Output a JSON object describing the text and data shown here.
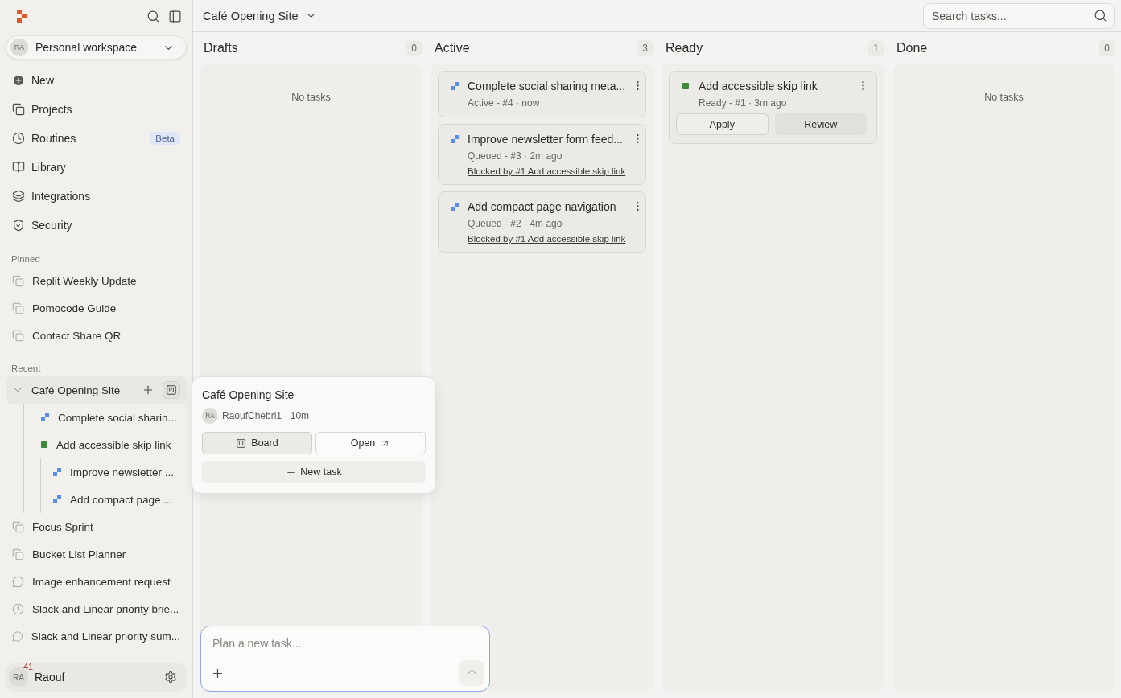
{
  "sidebar": {
    "workspace": {
      "avatar": "RA",
      "name": "Personal workspace"
    },
    "nav": [
      {
        "label": "New",
        "kind": "new"
      },
      {
        "label": "Projects",
        "kind": "projects"
      },
      {
        "label": "Routines",
        "kind": "routines",
        "badge": "Beta"
      },
      {
        "label": "Library",
        "kind": "library"
      },
      {
        "label": "Integrations",
        "kind": "integrations"
      },
      {
        "label": "Security",
        "kind": "security"
      }
    ],
    "pinned": {
      "title": "Pinned",
      "items": [
        {
          "label": "Replit Weekly Update",
          "kind": "project"
        },
        {
          "label": "Pomocode Guide",
          "kind": "project"
        },
        {
          "label": "Contact Share QR",
          "kind": "project"
        }
      ]
    },
    "recent": {
      "title": "Recent",
      "items": [
        {
          "label": "Café Opening Site",
          "kind": "project",
          "selected": true,
          "expanded": true,
          "children": [
            {
              "label": "Complete social sharin...",
              "kind": "task",
              "color": "#5b8def"
            },
            {
              "label": "Add accessible skip link",
              "kind": "task",
              "color": "#3f8a3a",
              "children": [
                {
                  "label": "Improve newsletter ...",
                  "kind": "task",
                  "color": "#5b8def"
                },
                {
                  "label": "Add compact page ...",
                  "kind": "task",
                  "color": "#5b8def"
                }
              ]
            }
          ]
        },
        {
          "label": "Focus Sprint",
          "kind": "project",
          "selected": false
        },
        {
          "label": "Bucket List Planner",
          "kind": "project",
          "selected": false
        },
        {
          "label": "Image enhancement request",
          "kind": "chat",
          "selected": false
        },
        {
          "label": "Slack and Linear priority brie...",
          "kind": "routine",
          "selected": false
        },
        {
          "label": "Slack and Linear priority sum...",
          "kind": "chat",
          "selected": false
        }
      ]
    },
    "user": {
      "avatar": "RA",
      "name": "Raouf",
      "notifications": "41"
    }
  },
  "header": {
    "title": "Café Opening Site",
    "search": {
      "placeholder": "Search tasks..."
    }
  },
  "columns": [
    {
      "title": "Drafts",
      "count": "0",
      "empty_text": "No tasks"
    },
    {
      "title": "Active",
      "count": "3",
      "tasks": [
        {
          "title": "Complete social sharing meta...",
          "meta": "Active - #4 · now",
          "color": "#5b8def"
        },
        {
          "title": "Improve newsletter form feed...",
          "meta": "Queued - #3 · 2m ago",
          "color": "#5b8def",
          "blocked": "Blocked by #1 Add accessible skip link"
        },
        {
          "title": "Add compact page navigation",
          "meta": "Queued - #2 · 4m ago",
          "color": "#5b8def",
          "blocked": "Blocked by #1 Add accessible skip link"
        }
      ]
    },
    {
      "title": "Ready",
      "count": "1",
      "tasks": [
        {
          "title": "Add accessible skip link",
          "meta": "Ready - #1 · 3m ago",
          "color": "#3f8a3a",
          "actions": [
            {
              "label": "Apply",
              "kind": "outline"
            },
            {
              "label": "Review",
              "kind": "filled"
            }
          ]
        }
      ]
    },
    {
      "title": "Done",
      "count": "0",
      "empty_text": "No tasks"
    }
  ],
  "popover": {
    "title": "Café Opening Site",
    "avatar": "RA",
    "meta": "RaoufChebri1 · 10m",
    "buttons": [
      {
        "label": "Board",
        "kind": "board",
        "selected": true
      },
      {
        "label": "Open",
        "kind": "open",
        "selected": false
      }
    ],
    "new_task": "New task"
  },
  "composer": {
    "placeholder": "Plan a new task..."
  }
}
